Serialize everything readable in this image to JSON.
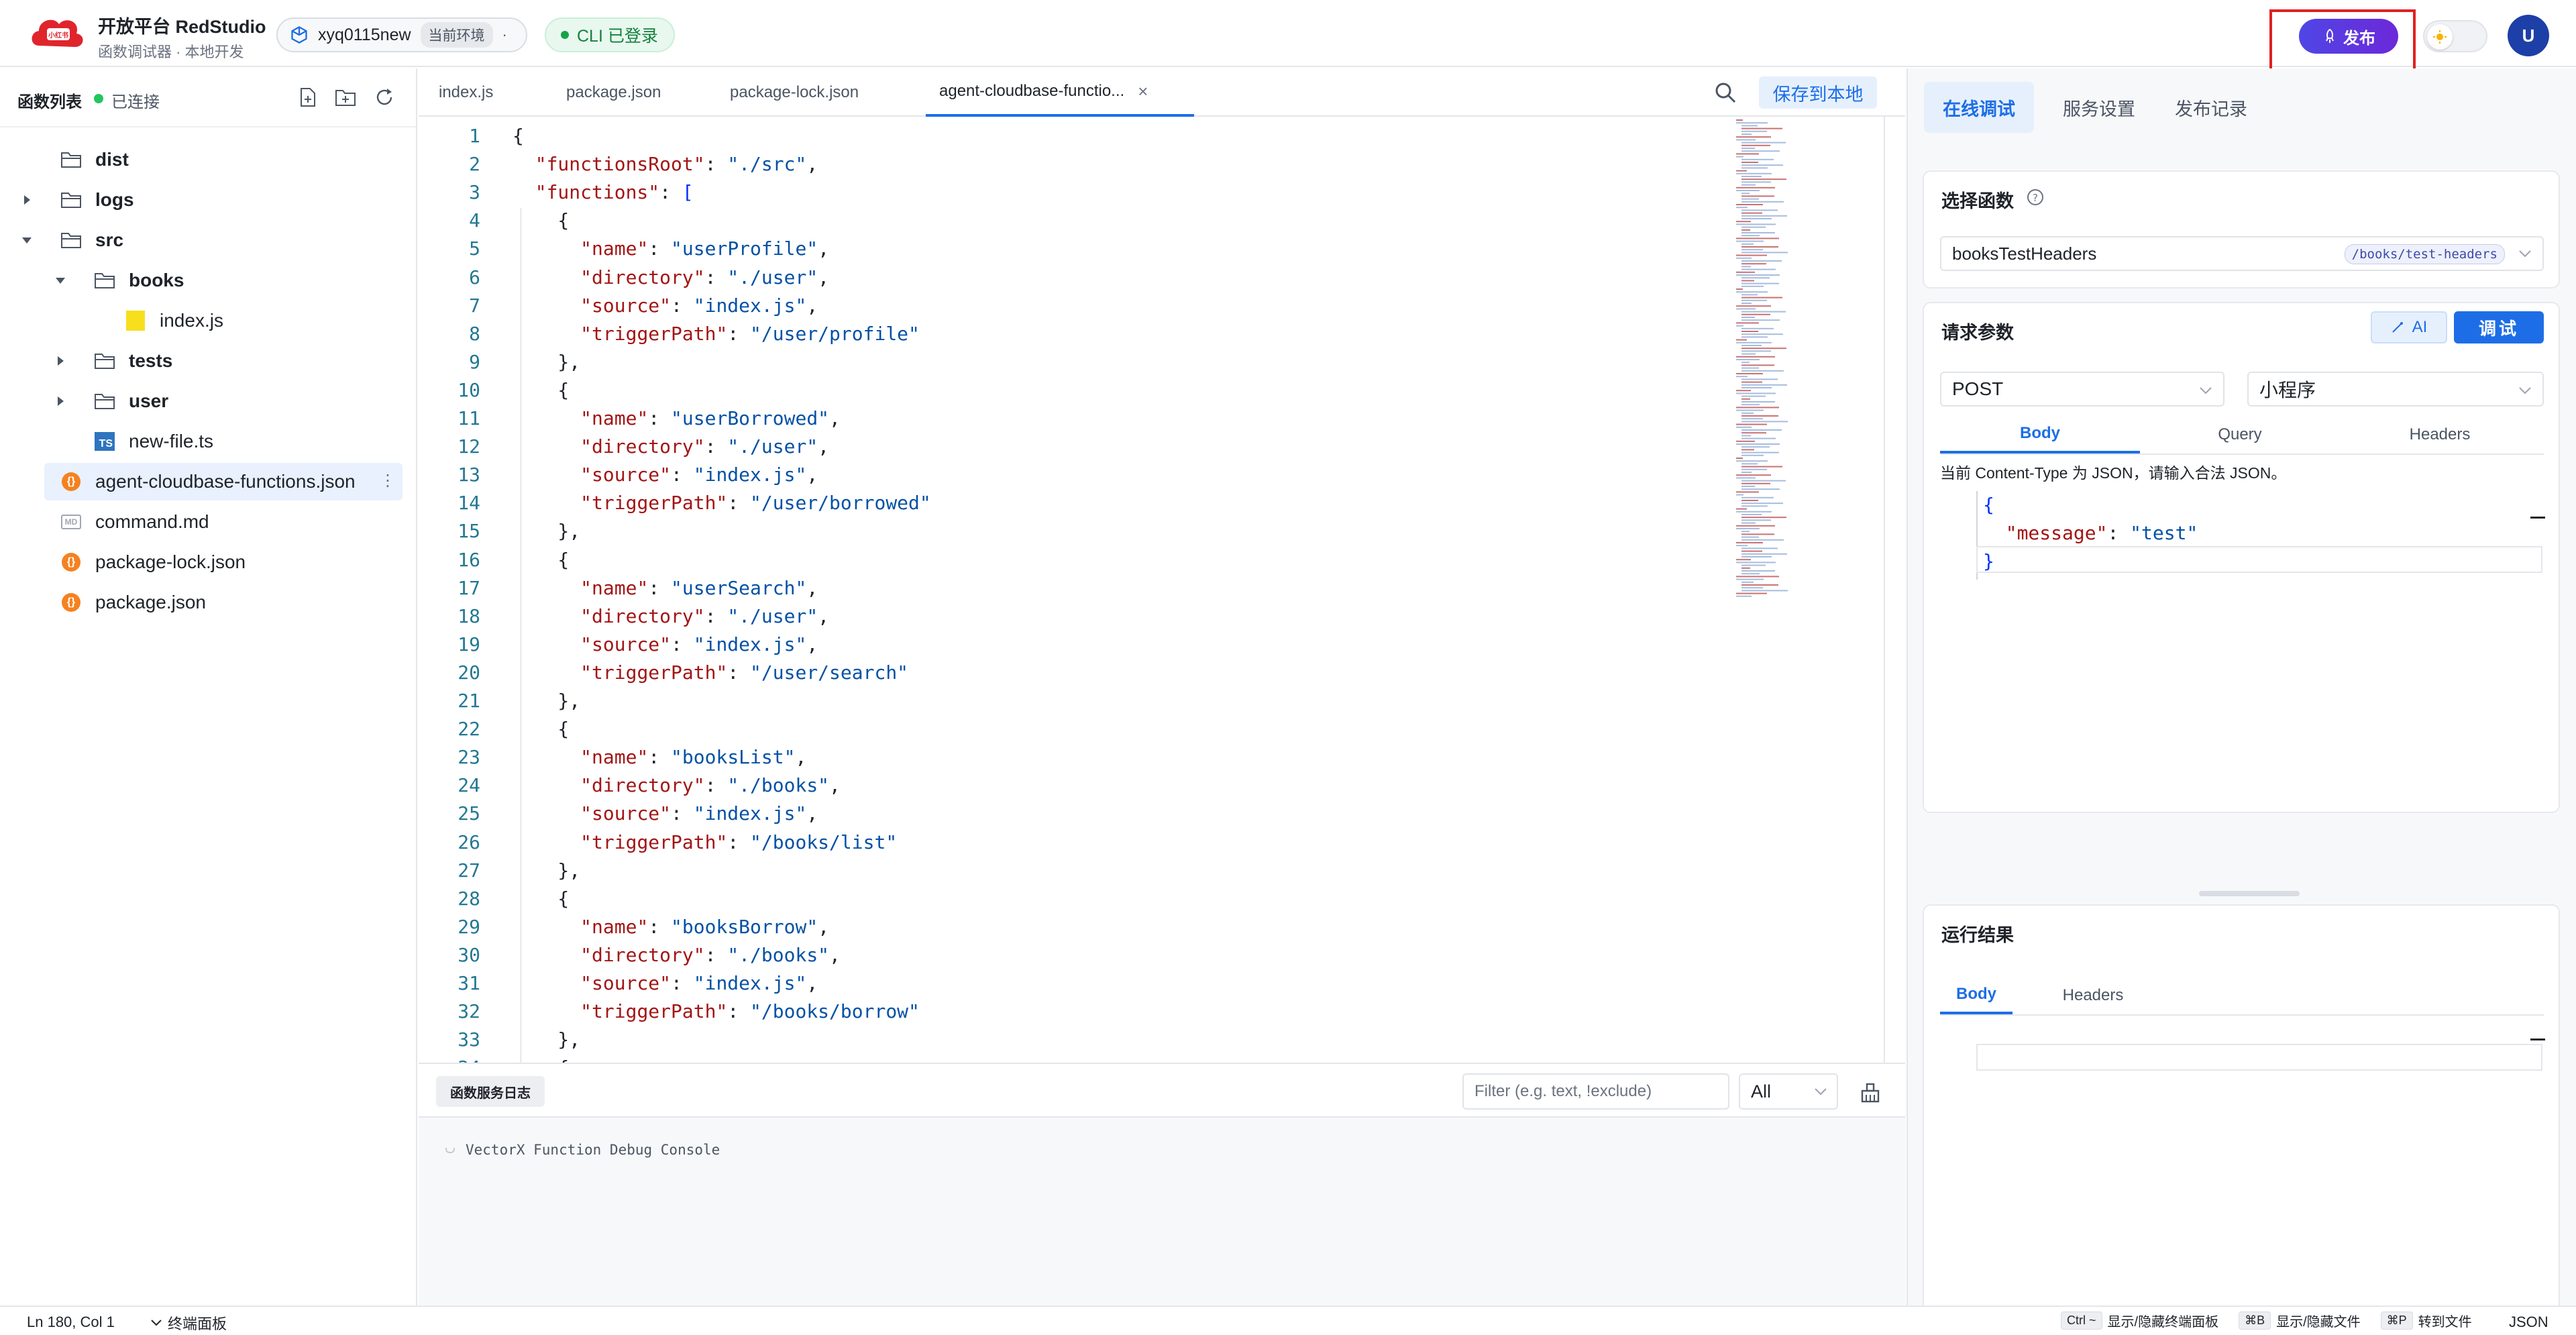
{
  "header": {
    "app_title": "开放平台 RedStudio",
    "app_subtitle": "函数调试器 · 本地开发",
    "env_name": "xyq0115new",
    "env_tag": "当前环境",
    "env_dot": "·",
    "cli_status": "CLI 已登录",
    "publish_label": "发布",
    "avatar_initial": "U"
  },
  "sidebar": {
    "title": "函数列表",
    "status": "已连接",
    "tree": [
      {
        "label": "dist",
        "type": "folder",
        "depth": 0,
        "expanded": false,
        "has_chevron": false
      },
      {
        "label": "logs",
        "type": "folder",
        "depth": 0,
        "expanded": false,
        "has_chevron": true
      },
      {
        "label": "src",
        "type": "folder",
        "depth": 0,
        "expanded": true,
        "has_chevron": true
      },
      {
        "label": "books",
        "type": "folder",
        "depth": 1,
        "expanded": true,
        "has_chevron": true
      },
      {
        "label": "index.js",
        "type": "js",
        "depth": 2
      },
      {
        "label": "tests",
        "type": "folder",
        "depth": 1,
        "expanded": false,
        "has_chevron": true
      },
      {
        "label": "user",
        "type": "folder",
        "depth": 1,
        "expanded": false,
        "has_chevron": true
      },
      {
        "label": "new-file.ts",
        "type": "ts",
        "depth": 1
      },
      {
        "label": "agent-cloudbase-functions.json",
        "type": "json",
        "depth": 0,
        "selected": true,
        "more": "⋮"
      },
      {
        "label": "command.md",
        "type": "md",
        "depth": 0
      },
      {
        "label": "package-lock.json",
        "type": "json",
        "depth": 0
      },
      {
        "label": "package.json",
        "type": "json",
        "depth": 0
      }
    ]
  },
  "editor": {
    "tabs": [
      {
        "label": "index.js",
        "active": false
      },
      {
        "label": "package.json",
        "active": false
      },
      {
        "label": "package-lock.json",
        "active": false
      },
      {
        "label": "agent-cloudbase-functio...",
        "active": true,
        "close": "×"
      }
    ],
    "save_label": "保存到本地",
    "lines": [
      {
        "n": "1",
        "t": [
          [
            "p",
            "{"
          ]
        ]
      },
      {
        "n": "2",
        "t": [
          [
            "p",
            "  "
          ],
          [
            "k",
            "\"functionsRoot\""
          ],
          [
            "p",
            ": "
          ],
          [
            "s",
            "\"./src\""
          ],
          [
            "p",
            ","
          ]
        ]
      },
      {
        "n": "3",
        "t": [
          [
            "p",
            "  "
          ],
          [
            "k",
            "\"functions\""
          ],
          [
            "p",
            ": "
          ],
          [
            "b",
            "["
          ]
        ]
      },
      {
        "n": "4",
        "t": [
          [
            "p",
            "    {"
          ]
        ]
      },
      {
        "n": "5",
        "t": [
          [
            "p",
            "      "
          ],
          [
            "k",
            "\"name\""
          ],
          [
            "p",
            ": "
          ],
          [
            "s",
            "\"userProfile\""
          ],
          [
            "p",
            ","
          ]
        ]
      },
      {
        "n": "6",
        "t": [
          [
            "p",
            "      "
          ],
          [
            "k",
            "\"directory\""
          ],
          [
            "p",
            ": "
          ],
          [
            "s",
            "\"./user\""
          ],
          [
            "p",
            ","
          ]
        ]
      },
      {
        "n": "7",
        "t": [
          [
            "p",
            "      "
          ],
          [
            "k",
            "\"source\""
          ],
          [
            "p",
            ": "
          ],
          [
            "s",
            "\"index.js\""
          ],
          [
            "p",
            ","
          ]
        ]
      },
      {
        "n": "8",
        "t": [
          [
            "p",
            "      "
          ],
          [
            "k",
            "\"triggerPath\""
          ],
          [
            "p",
            ": "
          ],
          [
            "s",
            "\"/user/profile\""
          ]
        ]
      },
      {
        "n": "9",
        "t": [
          [
            "p",
            "    },"
          ]
        ]
      },
      {
        "n": "10",
        "t": [
          [
            "p",
            "    {"
          ]
        ]
      },
      {
        "n": "11",
        "t": [
          [
            "p",
            "      "
          ],
          [
            "k",
            "\"name\""
          ],
          [
            "p",
            ": "
          ],
          [
            "s",
            "\"userBorrowed\""
          ],
          [
            "p",
            ","
          ]
        ]
      },
      {
        "n": "12",
        "t": [
          [
            "p",
            "      "
          ],
          [
            "k",
            "\"directory\""
          ],
          [
            "p",
            ": "
          ],
          [
            "s",
            "\"./user\""
          ],
          [
            "p",
            ","
          ]
        ]
      },
      {
        "n": "13",
        "t": [
          [
            "p",
            "      "
          ],
          [
            "k",
            "\"source\""
          ],
          [
            "p",
            ": "
          ],
          [
            "s",
            "\"index.js\""
          ],
          [
            "p",
            ","
          ]
        ]
      },
      {
        "n": "14",
        "t": [
          [
            "p",
            "      "
          ],
          [
            "k",
            "\"triggerPath\""
          ],
          [
            "p",
            ": "
          ],
          [
            "s",
            "\"/user/borrowed\""
          ]
        ]
      },
      {
        "n": "15",
        "t": [
          [
            "p",
            "    },"
          ]
        ]
      },
      {
        "n": "16",
        "t": [
          [
            "p",
            "    {"
          ]
        ]
      },
      {
        "n": "17",
        "t": [
          [
            "p",
            "      "
          ],
          [
            "k",
            "\"name\""
          ],
          [
            "p",
            ": "
          ],
          [
            "s",
            "\"userSearch\""
          ],
          [
            "p",
            ","
          ]
        ]
      },
      {
        "n": "18",
        "t": [
          [
            "p",
            "      "
          ],
          [
            "k",
            "\"directory\""
          ],
          [
            "p",
            ": "
          ],
          [
            "s",
            "\"./user\""
          ],
          [
            "p",
            ","
          ]
        ]
      },
      {
        "n": "19",
        "t": [
          [
            "p",
            "      "
          ],
          [
            "k",
            "\"source\""
          ],
          [
            "p",
            ": "
          ],
          [
            "s",
            "\"index.js\""
          ],
          [
            "p",
            ","
          ]
        ]
      },
      {
        "n": "20",
        "t": [
          [
            "p",
            "      "
          ],
          [
            "k",
            "\"triggerPath\""
          ],
          [
            "p",
            ": "
          ],
          [
            "s",
            "\"/user/search\""
          ]
        ]
      },
      {
        "n": "21",
        "t": [
          [
            "p",
            "    },"
          ]
        ]
      },
      {
        "n": "22",
        "t": [
          [
            "p",
            "    {"
          ]
        ]
      },
      {
        "n": "23",
        "t": [
          [
            "p",
            "      "
          ],
          [
            "k",
            "\"name\""
          ],
          [
            "p",
            ": "
          ],
          [
            "s",
            "\"booksList\""
          ],
          [
            "p",
            ","
          ]
        ]
      },
      {
        "n": "24",
        "t": [
          [
            "p",
            "      "
          ],
          [
            "k",
            "\"directory\""
          ],
          [
            "p",
            ": "
          ],
          [
            "s",
            "\"./books\""
          ],
          [
            "p",
            ","
          ]
        ]
      },
      {
        "n": "25",
        "t": [
          [
            "p",
            "      "
          ],
          [
            "k",
            "\"source\""
          ],
          [
            "p",
            ": "
          ],
          [
            "s",
            "\"index.js\""
          ],
          [
            "p",
            ","
          ]
        ]
      },
      {
        "n": "26",
        "t": [
          [
            "p",
            "      "
          ],
          [
            "k",
            "\"triggerPath\""
          ],
          [
            "p",
            ": "
          ],
          [
            "s",
            "\"/books/list\""
          ]
        ]
      },
      {
        "n": "27",
        "t": [
          [
            "p",
            "    },"
          ]
        ]
      },
      {
        "n": "28",
        "t": [
          [
            "p",
            "    {"
          ]
        ]
      },
      {
        "n": "29",
        "t": [
          [
            "p",
            "      "
          ],
          [
            "k",
            "\"name\""
          ],
          [
            "p",
            ": "
          ],
          [
            "s",
            "\"booksBorrow\""
          ],
          [
            "p",
            ","
          ]
        ]
      },
      {
        "n": "30",
        "t": [
          [
            "p",
            "      "
          ],
          [
            "k",
            "\"directory\""
          ],
          [
            "p",
            ": "
          ],
          [
            "s",
            "\"./books\""
          ],
          [
            "p",
            ","
          ]
        ]
      },
      {
        "n": "31",
        "t": [
          [
            "p",
            "      "
          ],
          [
            "k",
            "\"source\""
          ],
          [
            "p",
            ": "
          ],
          [
            "s",
            "\"index.js\""
          ],
          [
            "p",
            ","
          ]
        ]
      },
      {
        "n": "32",
        "t": [
          [
            "p",
            "      "
          ],
          [
            "k",
            "\"triggerPath\""
          ],
          [
            "p",
            ": "
          ],
          [
            "s",
            "\"/books/borrow\""
          ]
        ]
      },
      {
        "n": "33",
        "t": [
          [
            "p",
            "    },"
          ]
        ]
      },
      {
        "n": "34",
        "t": [
          [
            "p",
            "    {"
          ]
        ]
      }
    ]
  },
  "log": {
    "tab_label": "函数服务日志",
    "filter_placeholder": "Filter (e.g. text, !exclude)",
    "level": "All",
    "console_line": "VectorX Function Debug Console"
  },
  "right": {
    "tabs": [
      "在线调试",
      "服务设置",
      "发布记录"
    ],
    "select_function_title": "选择函数",
    "selected_function": "booksTestHeaders",
    "selected_route": "/books/test-headers",
    "request_title": "请求参数",
    "ai_label": "AI",
    "debug_label": "调试",
    "method": "POST",
    "client": "小程序",
    "req_tabs": [
      "Body",
      "Query",
      "Headers"
    ],
    "body_note": "当前 Content-Type 为 JSON，请输入合法 JSON。",
    "body_lines": [
      [
        [
          "b",
          "{"
        ]
      ],
      [
        [
          "p",
          "  "
        ],
        [
          "k",
          "\"message\""
        ],
        [
          "p",
          ": "
        ],
        [
          "s",
          "\"test\""
        ]
      ],
      [
        [
          "b",
          "}"
        ]
      ]
    ],
    "result_title": "运行结果",
    "result_tabs": [
      "Body",
      "Headers"
    ]
  },
  "statusbar": {
    "position": "Ln 180, Col 1",
    "terminal_label": "终端面板",
    "hints": [
      {
        "key": "Ctrl ~",
        "text": "显示/隐藏终端面板"
      },
      {
        "key": "⌘B",
        "text": "显示/隐藏文件"
      },
      {
        "key": "⌘P",
        "text": "转到文件"
      }
    ],
    "language": "JSON"
  },
  "colors": {
    "accent": "#1d6ee6",
    "publish_gradient_start": "#4f46e5",
    "publish_gradient_end": "#6d28d9",
    "highlight_red": "#e02020",
    "connected_green": "#22c55e"
  }
}
